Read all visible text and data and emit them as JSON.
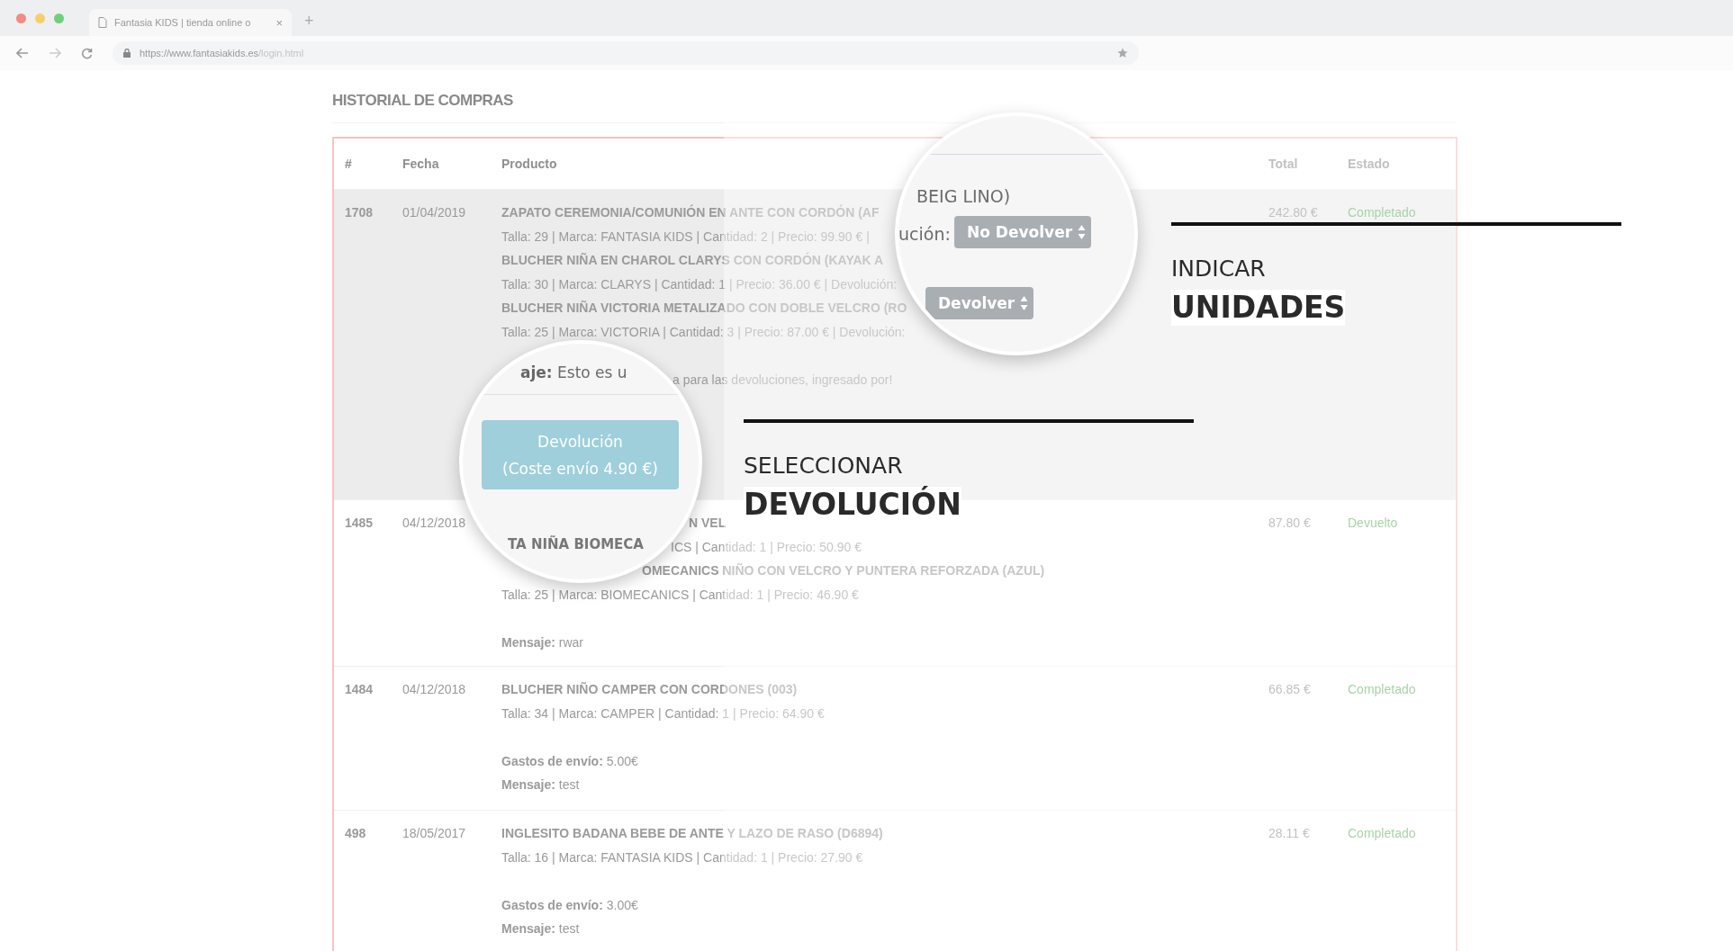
{
  "browser": {
    "tab_title": "Fantasia KIDS | tienda online o",
    "tab_close": "×",
    "new_tab": "+",
    "url_host": "https://www.fantasiakids.es",
    "url_path": "/login.html"
  },
  "heading": "HISTORIAL DE COMPRAS",
  "table": {
    "columns": [
      "#",
      "Fecha",
      "Producto",
      "Total",
      "Estado"
    ],
    "rows": [
      {
        "number": "1708",
        "date": "01/04/2019",
        "highlighted": true,
        "total": "242.80 €",
        "status": "Completado",
        "lines": [
          {
            "kind": "product",
            "text": "ZAPATO CEREMONIA/COMUNIÓN EN ANTE CON CORDÓN (AF"
          },
          {
            "kind": "detail",
            "text": "Talla: 29 | Marca: FANTASIA KIDS | Cantidad: 2 | Precio: 99.90 € |"
          },
          {
            "kind": "product",
            "text": "BLUCHER NIÑA EN CHAROL CLARYS CON CORDÓN (KAYAK A"
          },
          {
            "kind": "detail",
            "text": "Talla: 30 | Marca: CLARYS | Cantidad: 1 | Precio: 36.00 € | Devolución:"
          },
          {
            "kind": "product",
            "text": "BLUCHER NIÑA VICTORIA METALIZADO CON DOBLE VELCRO (RO"
          },
          {
            "kind": "detail",
            "text": "Talla: 25 | Marca: VICTORIA | Cantidad: 3 | Precio: 87.00 € | Devolución:"
          },
          {
            "kind": "fragment",
            "text": "a para las devoluciones, ingresado por!"
          }
        ]
      },
      {
        "number": "1485",
        "date": "04/12/2018",
        "highlighted": false,
        "total": "87.80 €",
        "status": "Devuelto",
        "lines": [
          {
            "kind": "fragment",
            "text": "N VEL"
          },
          {
            "kind": "fragment",
            "text": "ICS | Cantidad: 1 | Precio: 50.90 €"
          },
          {
            "kind": "fragment",
            "text": "OMECANICS NIÑO CON VELCRO Y PUNTERA REFORZADA (AZUL)"
          },
          {
            "kind": "detail",
            "text": "Talla: 25 | Marca: BIOMECANICS | Cantidad: 1 | Precio: 46.90 €"
          },
          {
            "kind": "meta",
            "text": "**Mensaje:** rwar"
          }
        ]
      },
      {
        "number": "1484",
        "date": "04/12/2018",
        "highlighted": false,
        "total": "66.85 €",
        "status": "Completado",
        "lines": [
          {
            "kind": "product",
            "text": "BLUCHER NIÑO CAMPER CON CORDONES (003)"
          },
          {
            "kind": "detail",
            "text": "Talla: 34 | Marca: CAMPER | Cantidad: 1 | Precio: 64.90 €"
          },
          {
            "kind": "meta",
            "text": "**Gastos de envío:** 5.00€"
          },
          {
            "kind": "meta",
            "text": "**Mensaje:** test"
          }
        ]
      },
      {
        "number": "498",
        "date": "18/05/2017",
        "highlighted": false,
        "total": "28.11 €",
        "status": "Completado",
        "lines": [
          {
            "kind": "product",
            "text": "INGLESITO BADANA BEBE DE ANTE Y LAZO DE RASO (D6894)"
          },
          {
            "kind": "detail",
            "text": "Talla: 16 | Marca: FANTASIA KIDS | Cantidad: 1 | Precio: 27.90 €"
          },
          {
            "kind": "meta",
            "text": "**Gastos de envío:** 3.00€"
          },
          {
            "kind": "meta",
            "text": "**Mensaje:** test"
          }
        ]
      }
    ]
  },
  "lenses": [
    {
      "kind": "button",
      "top_text": "**aje:** Esto es u",
      "button_lines": [
        "Devolución",
        "(Coste envío 4.90 €)"
      ],
      "bottom_text": "TA NIÑA BIOMECA"
    },
    {
      "kind": "selects",
      "top_text": "BEIG LINO)",
      "label": "ución:",
      "selects": [
        "No Devolver",
        "Devolver"
      ]
    }
  ],
  "callouts": [
    {
      "text": "INDICAR",
      "emphasis": "UNIDADES"
    },
    {
      "text": "SELECCIONAR",
      "emphasis": "DEVOLUCIÓN"
    }
  ]
}
